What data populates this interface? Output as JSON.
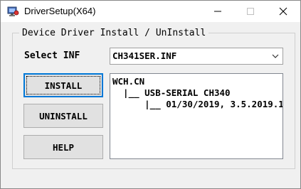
{
  "window": {
    "title": "DriverSetup(X64)",
    "controls": {
      "minimize": "minimize",
      "maximize": "maximize",
      "close": "close"
    }
  },
  "group": {
    "label": "Device Driver Install / UnInstall"
  },
  "select_inf": {
    "label": "Select INF",
    "value": "CH341SER.INF"
  },
  "buttons": {
    "install": "INSTALL",
    "uninstall": "UNINSTALL",
    "help": "HELP"
  },
  "tree": {
    "lines": [
      "WCH.CN",
      "  |__ USB-SERIAL CH340",
      "      |__ 01/30/2019, 3.5.2019.1"
    ]
  },
  "icons": {
    "app": "driver-setup-icon",
    "dropdown": "chevron-down-icon"
  }
}
